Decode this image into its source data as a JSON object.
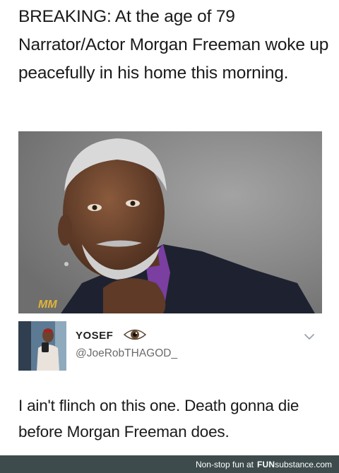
{
  "post": {
    "headline": "BREAKING: At the age of 79 Narrator/Actor Morgan Freeman woke up peacefully in his home this morning.",
    "image_watermark": "MM"
  },
  "tweet": {
    "author_name": "YOSEF",
    "author_emoji": "eye-icon",
    "handle": "@JoeRobTHAGOD_",
    "text": "I ain't flinch on this one. Death gonna die before Morgan Freeman does.",
    "menu_icon": "chevron-down-icon"
  },
  "footer": {
    "tagline": "Non-stop fun at",
    "brand_part1": "FUN",
    "brand_part2": "substance",
    "brand_part3": ".com"
  },
  "colors": {
    "footer_bg": "#3e4b4d",
    "handle_gray": "#6b6b6b",
    "watermark_gold": "#e0b43a"
  }
}
